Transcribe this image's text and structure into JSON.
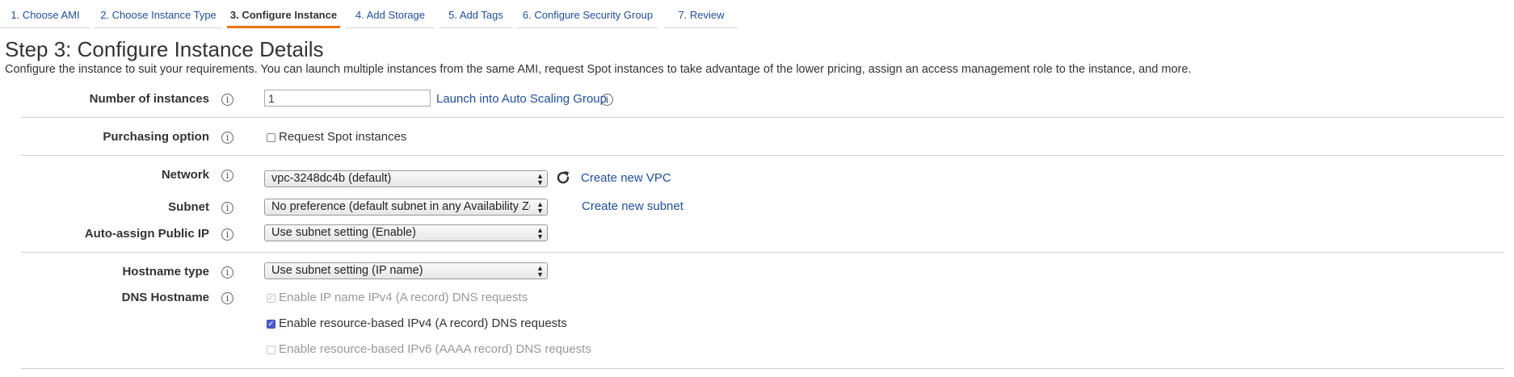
{
  "wizard": {
    "steps": [
      {
        "label": "1. Choose AMI"
      },
      {
        "label": "2. Choose Instance Type"
      },
      {
        "label": "3. Configure Instance",
        "active": true
      },
      {
        "label": "4. Add Storage"
      },
      {
        "label": "5. Add Tags"
      },
      {
        "label": "6. Configure Security Group"
      },
      {
        "label": "7. Review"
      }
    ]
  },
  "page": {
    "title": "Step 3: Configure Instance Details",
    "description": "Configure the instance to suit your requirements. You can launch multiple instances from the same AMI, request Spot instances to take advantage of the lower pricing, assign an access management role to the instance, and more."
  },
  "form": {
    "instances": {
      "label": "Number of instances",
      "value": "1",
      "link": "Launch into Auto Scaling Group"
    },
    "purchasing": {
      "label": "Purchasing option",
      "checkbox_label": "Request Spot instances",
      "checked": false
    },
    "network": {
      "label": "Network",
      "value": "vpc-3248dc4b (default)",
      "link": "Create new VPC"
    },
    "subnet": {
      "label": "Subnet",
      "value": "No preference (default subnet in any Availability Zo",
      "link": "Create new subnet"
    },
    "public_ip": {
      "label": "Auto-assign Public IP",
      "value": "Use subnet setting (Enable)"
    },
    "hostname_type": {
      "label": "Hostname type",
      "value": "Use subnet setting (IP name)"
    },
    "dns_hostname": {
      "label": "DNS Hostname",
      "options": [
        {
          "label": "Enable IP name IPv4 (A record) DNS requests",
          "checked": true,
          "disabled": true
        },
        {
          "label": "Enable resource-based IPv4 (A record) DNS requests",
          "checked": true,
          "disabled": false
        },
        {
          "label": "Enable resource-based IPv6 (AAAA record) DNS requests",
          "checked": false,
          "disabled": true
        }
      ]
    }
  },
  "icons": {
    "info": "info-icon",
    "refresh": "refresh-icon",
    "select_arrows": "select-arrows-icon"
  },
  "colors": {
    "link": "#1f4fa3",
    "active_tab_underline": "#ec7211",
    "checkbox_checked": "#4a5bd4"
  }
}
